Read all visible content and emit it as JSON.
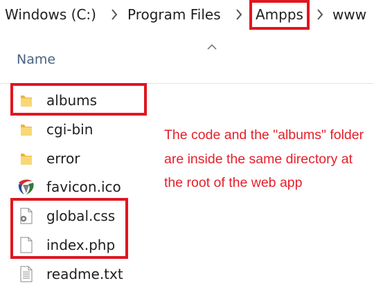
{
  "breadcrumb": {
    "items": [
      "Windows (C:)",
      "Program Files",
      "Ampps",
      "www"
    ]
  },
  "columns": {
    "name_header": "Name",
    "sort_indicator": "caret-up-icon"
  },
  "files": [
    {
      "name": "albums",
      "type": "folder",
      "icon": "folder-icon"
    },
    {
      "name": "cgi-bin",
      "type": "folder",
      "icon": "folder-icon"
    },
    {
      "name": "error",
      "type": "folder",
      "icon": "folder-icon"
    },
    {
      "name": "favicon.ico",
      "type": "icon-file",
      "icon": "favicon-icon"
    },
    {
      "name": "global.css",
      "type": "css-file",
      "icon": "css-file-icon"
    },
    {
      "name": "index.php",
      "type": "php-file",
      "icon": "blank-file-icon"
    },
    {
      "name": "readme.txt",
      "type": "text-file",
      "icon": "text-file-icon"
    }
  ],
  "annotation": {
    "text": "The code and the \"albums\" folder are inside the same directory at the root of the web app"
  },
  "colors": {
    "highlight": "#e0161f",
    "annotation": "#e5202a",
    "folder": "#f4c542",
    "header_text": "#4a6380"
  }
}
